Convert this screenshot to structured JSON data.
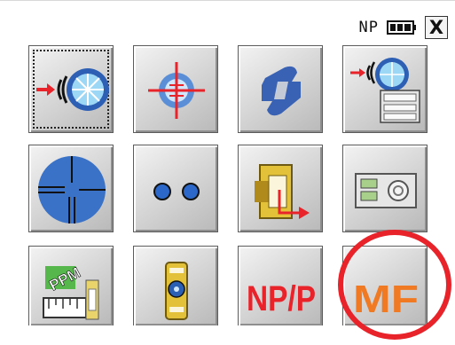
{
  "status_bar": {
    "mode": "NP",
    "battery_icon": "battery-icon",
    "close_label": "X"
  },
  "menu": [
    {
      "icon": "distance-measure-icon",
      "selected": true
    },
    {
      "icon": "target-stakeout-icon"
    },
    {
      "icon": "wave-symbol-icon"
    },
    {
      "icon": "measure-to-memory-icon"
    },
    {
      "icon": "reticle-circle-icon"
    },
    {
      "icon": "two-dots-icon"
    },
    {
      "icon": "prism-offset-icon"
    },
    {
      "icon": "memory-card-icon"
    },
    {
      "icon": "ppm-correction-icon",
      "label": "PPM"
    },
    {
      "icon": "tilt-level-icon"
    },
    {
      "icon": "np-p-switch-icon",
      "label": "NP/P"
    },
    {
      "icon": "mf-icon",
      "label": "MF"
    }
  ],
  "highlight": {
    "target": "MF",
    "color": "#e8232a"
  }
}
